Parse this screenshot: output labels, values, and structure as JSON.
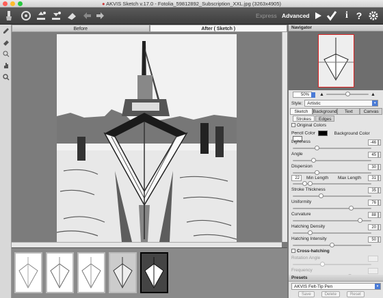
{
  "window": {
    "title": "AKVIS Sketch v.17.0 - Fotolia_59812892_Subscription_XXL.jpg (3263x4905)"
  },
  "toolbar": {
    "mode_express": "Express",
    "mode_advanced": "Advanced"
  },
  "view_tabs": {
    "before": "Before",
    "after": "After ( Sketch )"
  },
  "navigator": {
    "title": "Navigator",
    "zoom": "50%"
  },
  "style": {
    "label": "Style:",
    "value": "Artistic"
  },
  "panel_tabs": [
    "Sketch",
    "Background",
    "Text",
    "Canvas"
  ],
  "sub_tabs": [
    "Strokes",
    "Edges"
  ],
  "strokes": {
    "original_colors": "Original Colors",
    "pencil_color_label": "Pencil Color",
    "background_color_label": "Background Color",
    "pencil_color": "#000000",
    "background_color": "#ffffff",
    "lightness": {
      "label": "Lightness",
      "value": "-46",
      "pos": 0.3
    },
    "angle": {
      "label": "Angle",
      "value": "45",
      "pos": 0.25
    },
    "dispersion": {
      "label": "Dispersion",
      "value": "30",
      "pos": 0.3
    },
    "min_length": {
      "label": "Min Length",
      "value": "22"
    },
    "max_length": {
      "label": "Max Length",
      "value": "31"
    },
    "stroke_thickness": {
      "label": "Stroke Thickness",
      "value": "35",
      "pos": 0.35
    },
    "uniformity": {
      "label": "Uniformity",
      "value": "76",
      "pos": 0.76
    },
    "curvature": {
      "label": "Curvature",
      "value": "88",
      "pos": 0.88
    },
    "hatching_density": {
      "label": "Hatching Density",
      "value": "20",
      "pos": 0.2
    },
    "hatching_intensity": {
      "label": "Hatching Intensity",
      "value": "50",
      "pos": 0.5
    },
    "cross_hatching": "Cross-hatching",
    "rotation_angle": "Rotation Angle",
    "frequency": "Frequency"
  },
  "presets": {
    "title": "Presets",
    "value": "AKVIS Felt-Tip Pen",
    "save": "Save",
    "delete": "Delete",
    "reset": "Reset"
  }
}
